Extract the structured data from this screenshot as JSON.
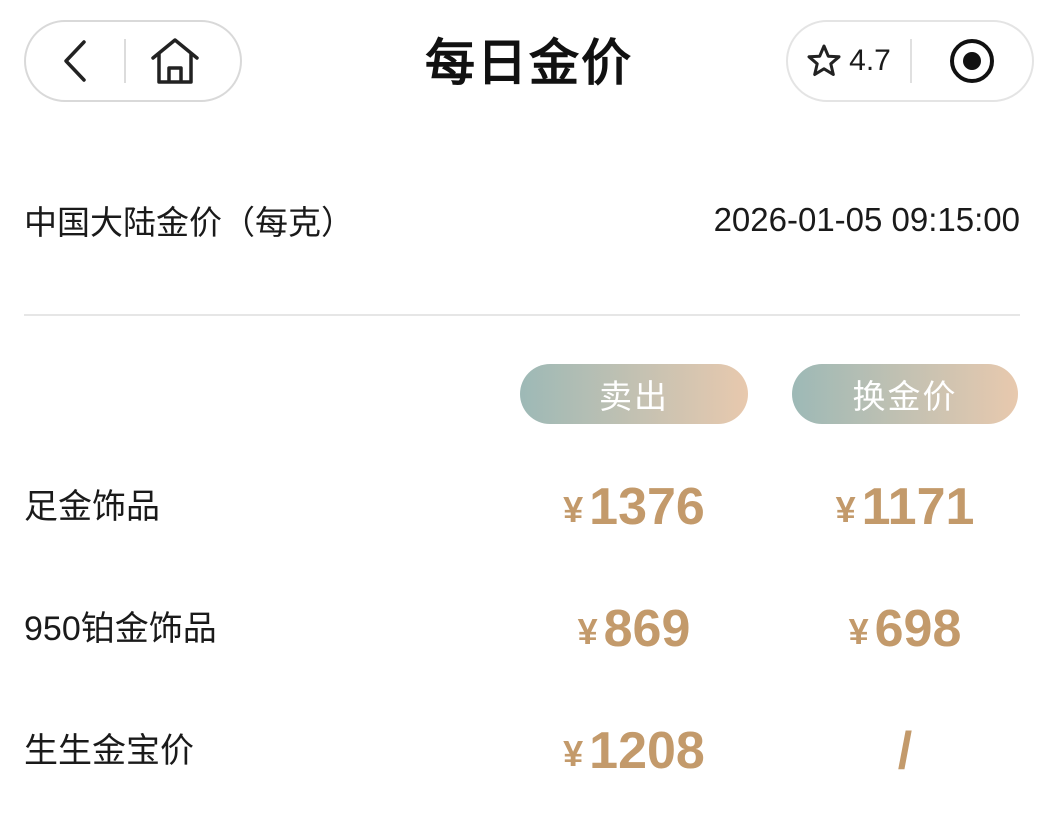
{
  "header": {
    "title": "每日金价",
    "rating": "4.7",
    "icons": {
      "back": "chevron-left-icon",
      "home": "home-icon",
      "rating": "star-outline-icon",
      "more": "target-icon"
    }
  },
  "region": {
    "label": "中国大陆金价（每克）",
    "datetime": "2026-01-05 09:15:00"
  },
  "columns": {
    "sell": "卖出",
    "exchange": "换金价"
  },
  "currency_symbol": "¥",
  "rows": [
    {
      "name": "足金饰品",
      "sell": "1376",
      "exchange": "1171"
    },
    {
      "name": "950铂金饰品",
      "sell": "869",
      "exchange": "698"
    },
    {
      "name": "生生金宝价",
      "sell": "1208",
      "exchange": "/"
    }
  ],
  "colors": {
    "price": "#c39a6b",
    "pill_gradient_start": "#9db9b6",
    "pill_gradient_end": "#e8c9ae"
  }
}
